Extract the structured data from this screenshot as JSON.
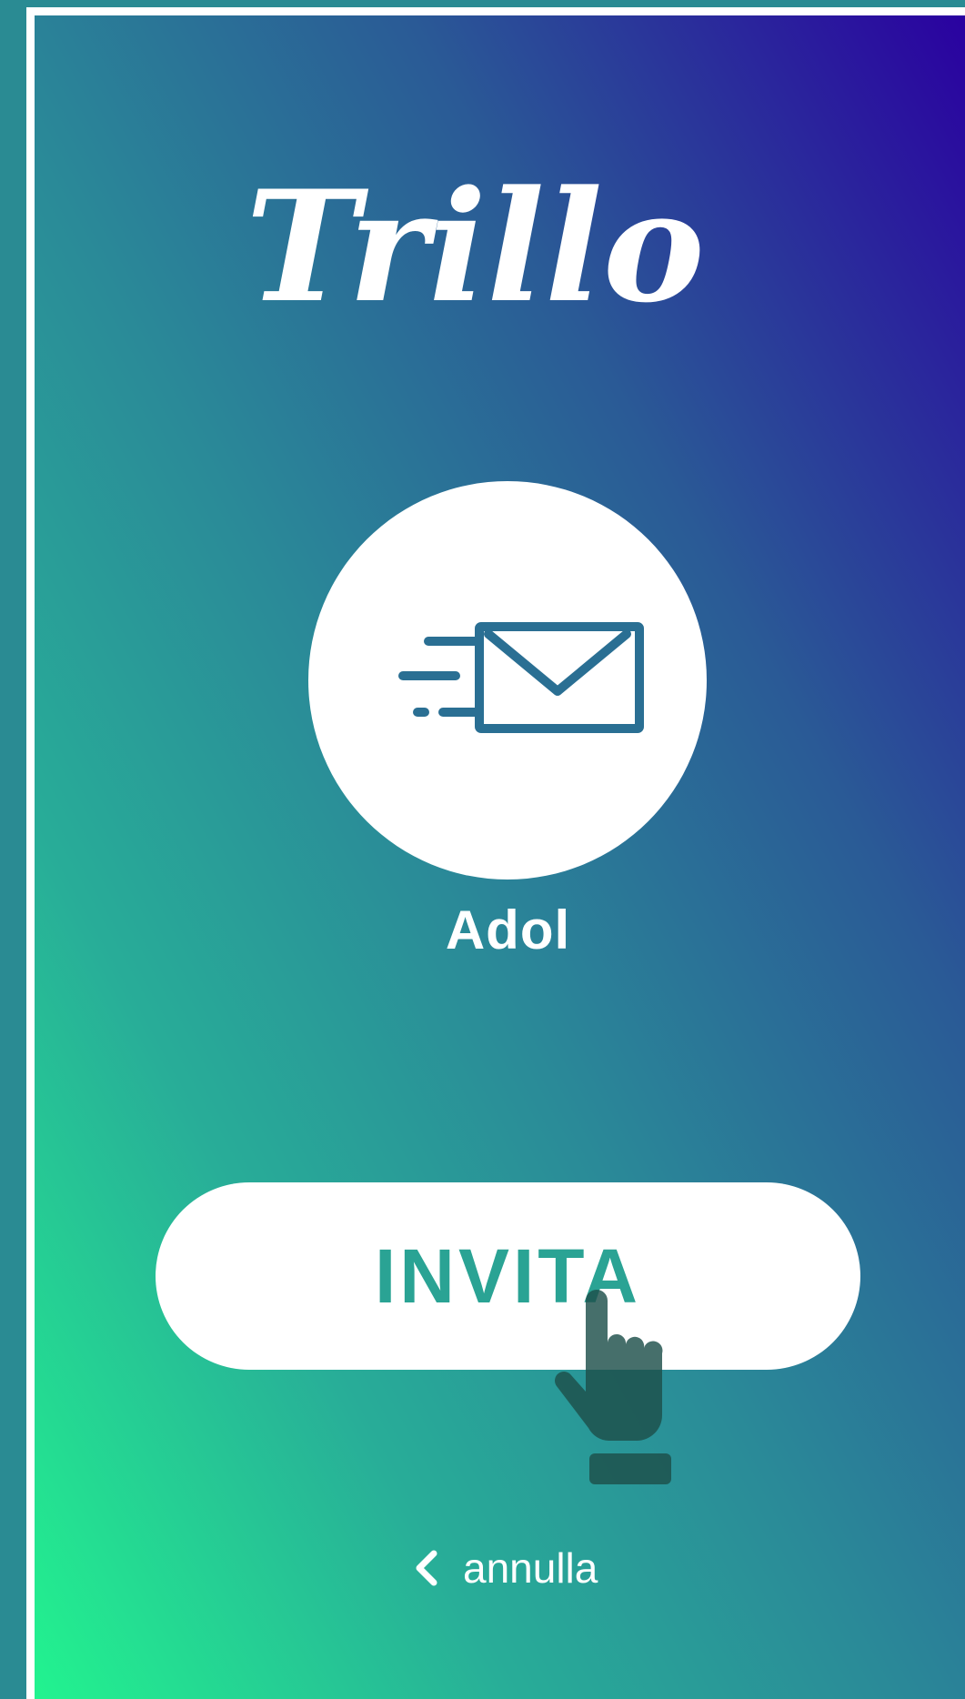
{
  "app": {
    "logo_text": "Trillo"
  },
  "contact": {
    "icon": "envelope-fast-icon",
    "name": "Adol"
  },
  "actions": {
    "invite_label": "INVITA",
    "cancel_label": "annulla",
    "cancel_icon": "chevron-left-icon"
  },
  "colors": {
    "accent": "#2aa394",
    "gradient_start": "#22f48f",
    "gradient_end": "#2a00a0",
    "icon_blue": "#2a6f93",
    "cursor": "#1d4f4a"
  }
}
